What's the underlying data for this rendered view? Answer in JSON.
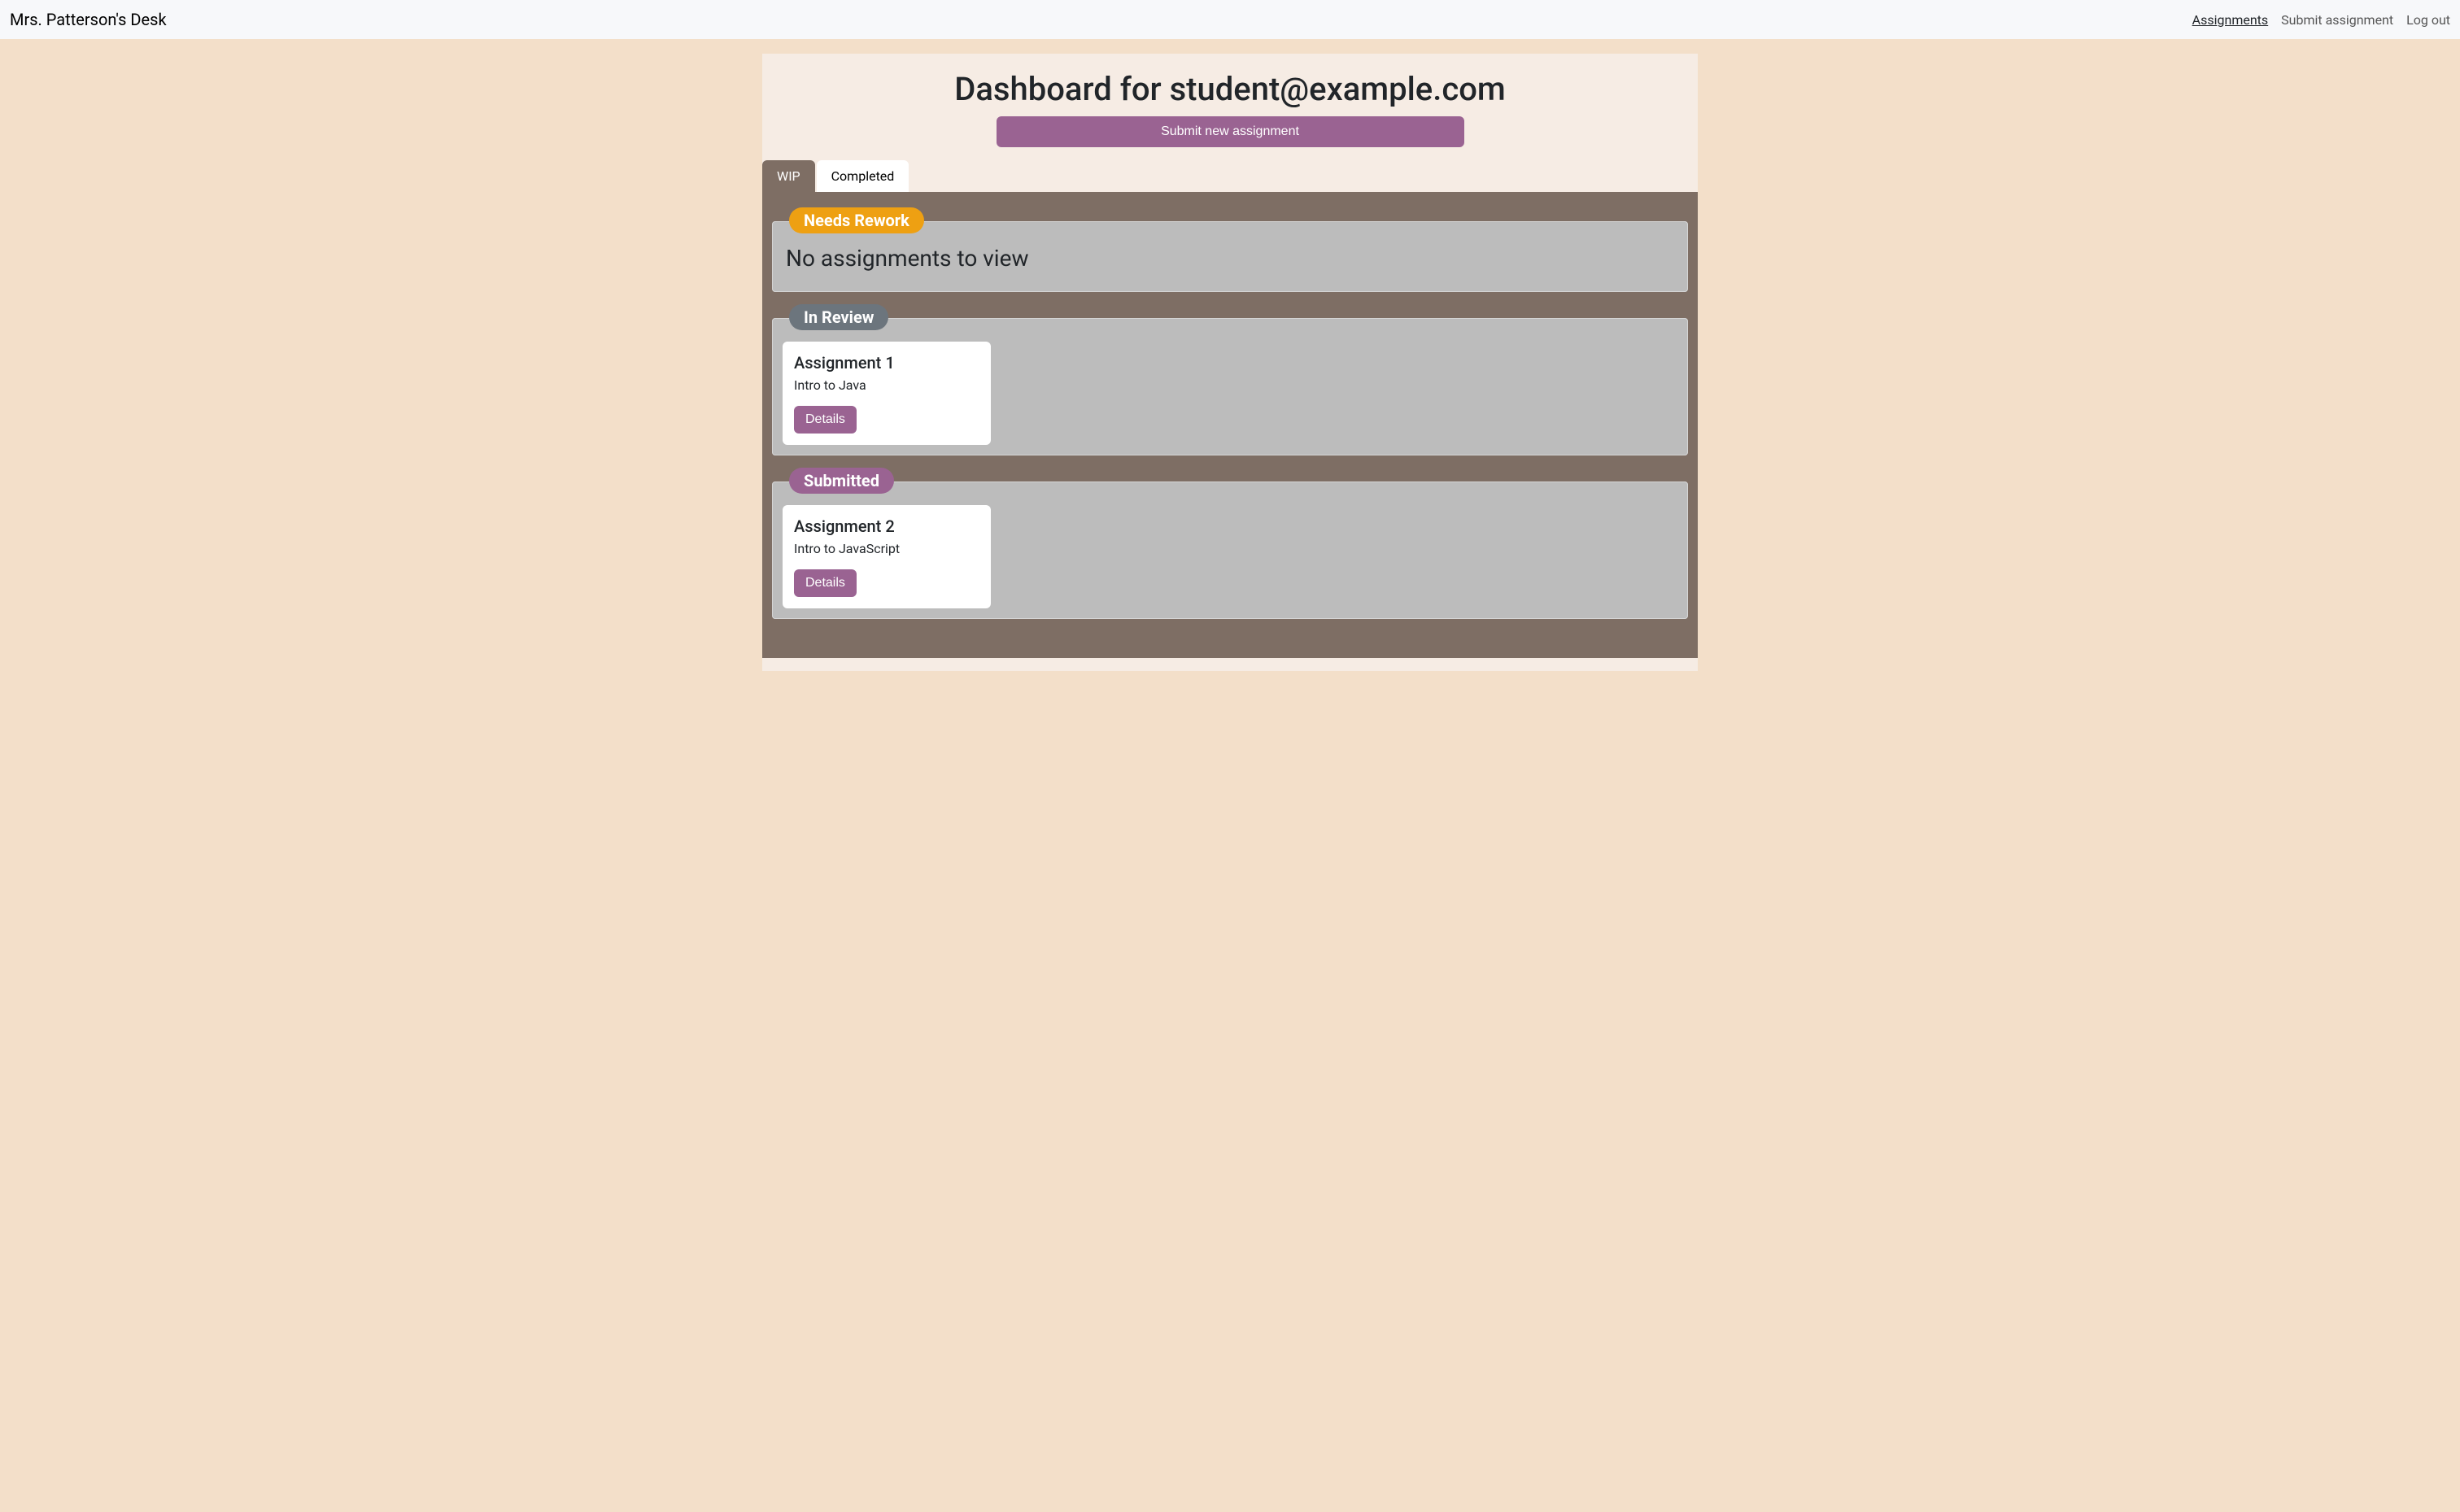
{
  "navbar": {
    "brand": "Mrs. Patterson's Desk",
    "links": [
      {
        "label": "Assignments",
        "active": true
      },
      {
        "label": "Submit assignment",
        "active": false
      },
      {
        "label": "Log out",
        "active": false
      }
    ]
  },
  "page": {
    "title": "Dashboard for student@example.com",
    "submit_button": "Submit new assignment"
  },
  "tabs": [
    {
      "label": "WIP",
      "active": true
    },
    {
      "label": "Completed",
      "active": false
    }
  ],
  "sections": {
    "needs_rework": {
      "label": "Needs Rework",
      "empty_message": "No assignments to view",
      "cards": []
    },
    "in_review": {
      "label": "In Review",
      "cards": [
        {
          "title": "Assignment 1",
          "subtitle": "Intro to Java",
          "button": "Details"
        }
      ]
    },
    "submitted": {
      "label": "Submitted",
      "cards": [
        {
          "title": "Assignment 2",
          "subtitle": "Intro to JavaScript",
          "button": "Details"
        }
      ]
    }
  }
}
